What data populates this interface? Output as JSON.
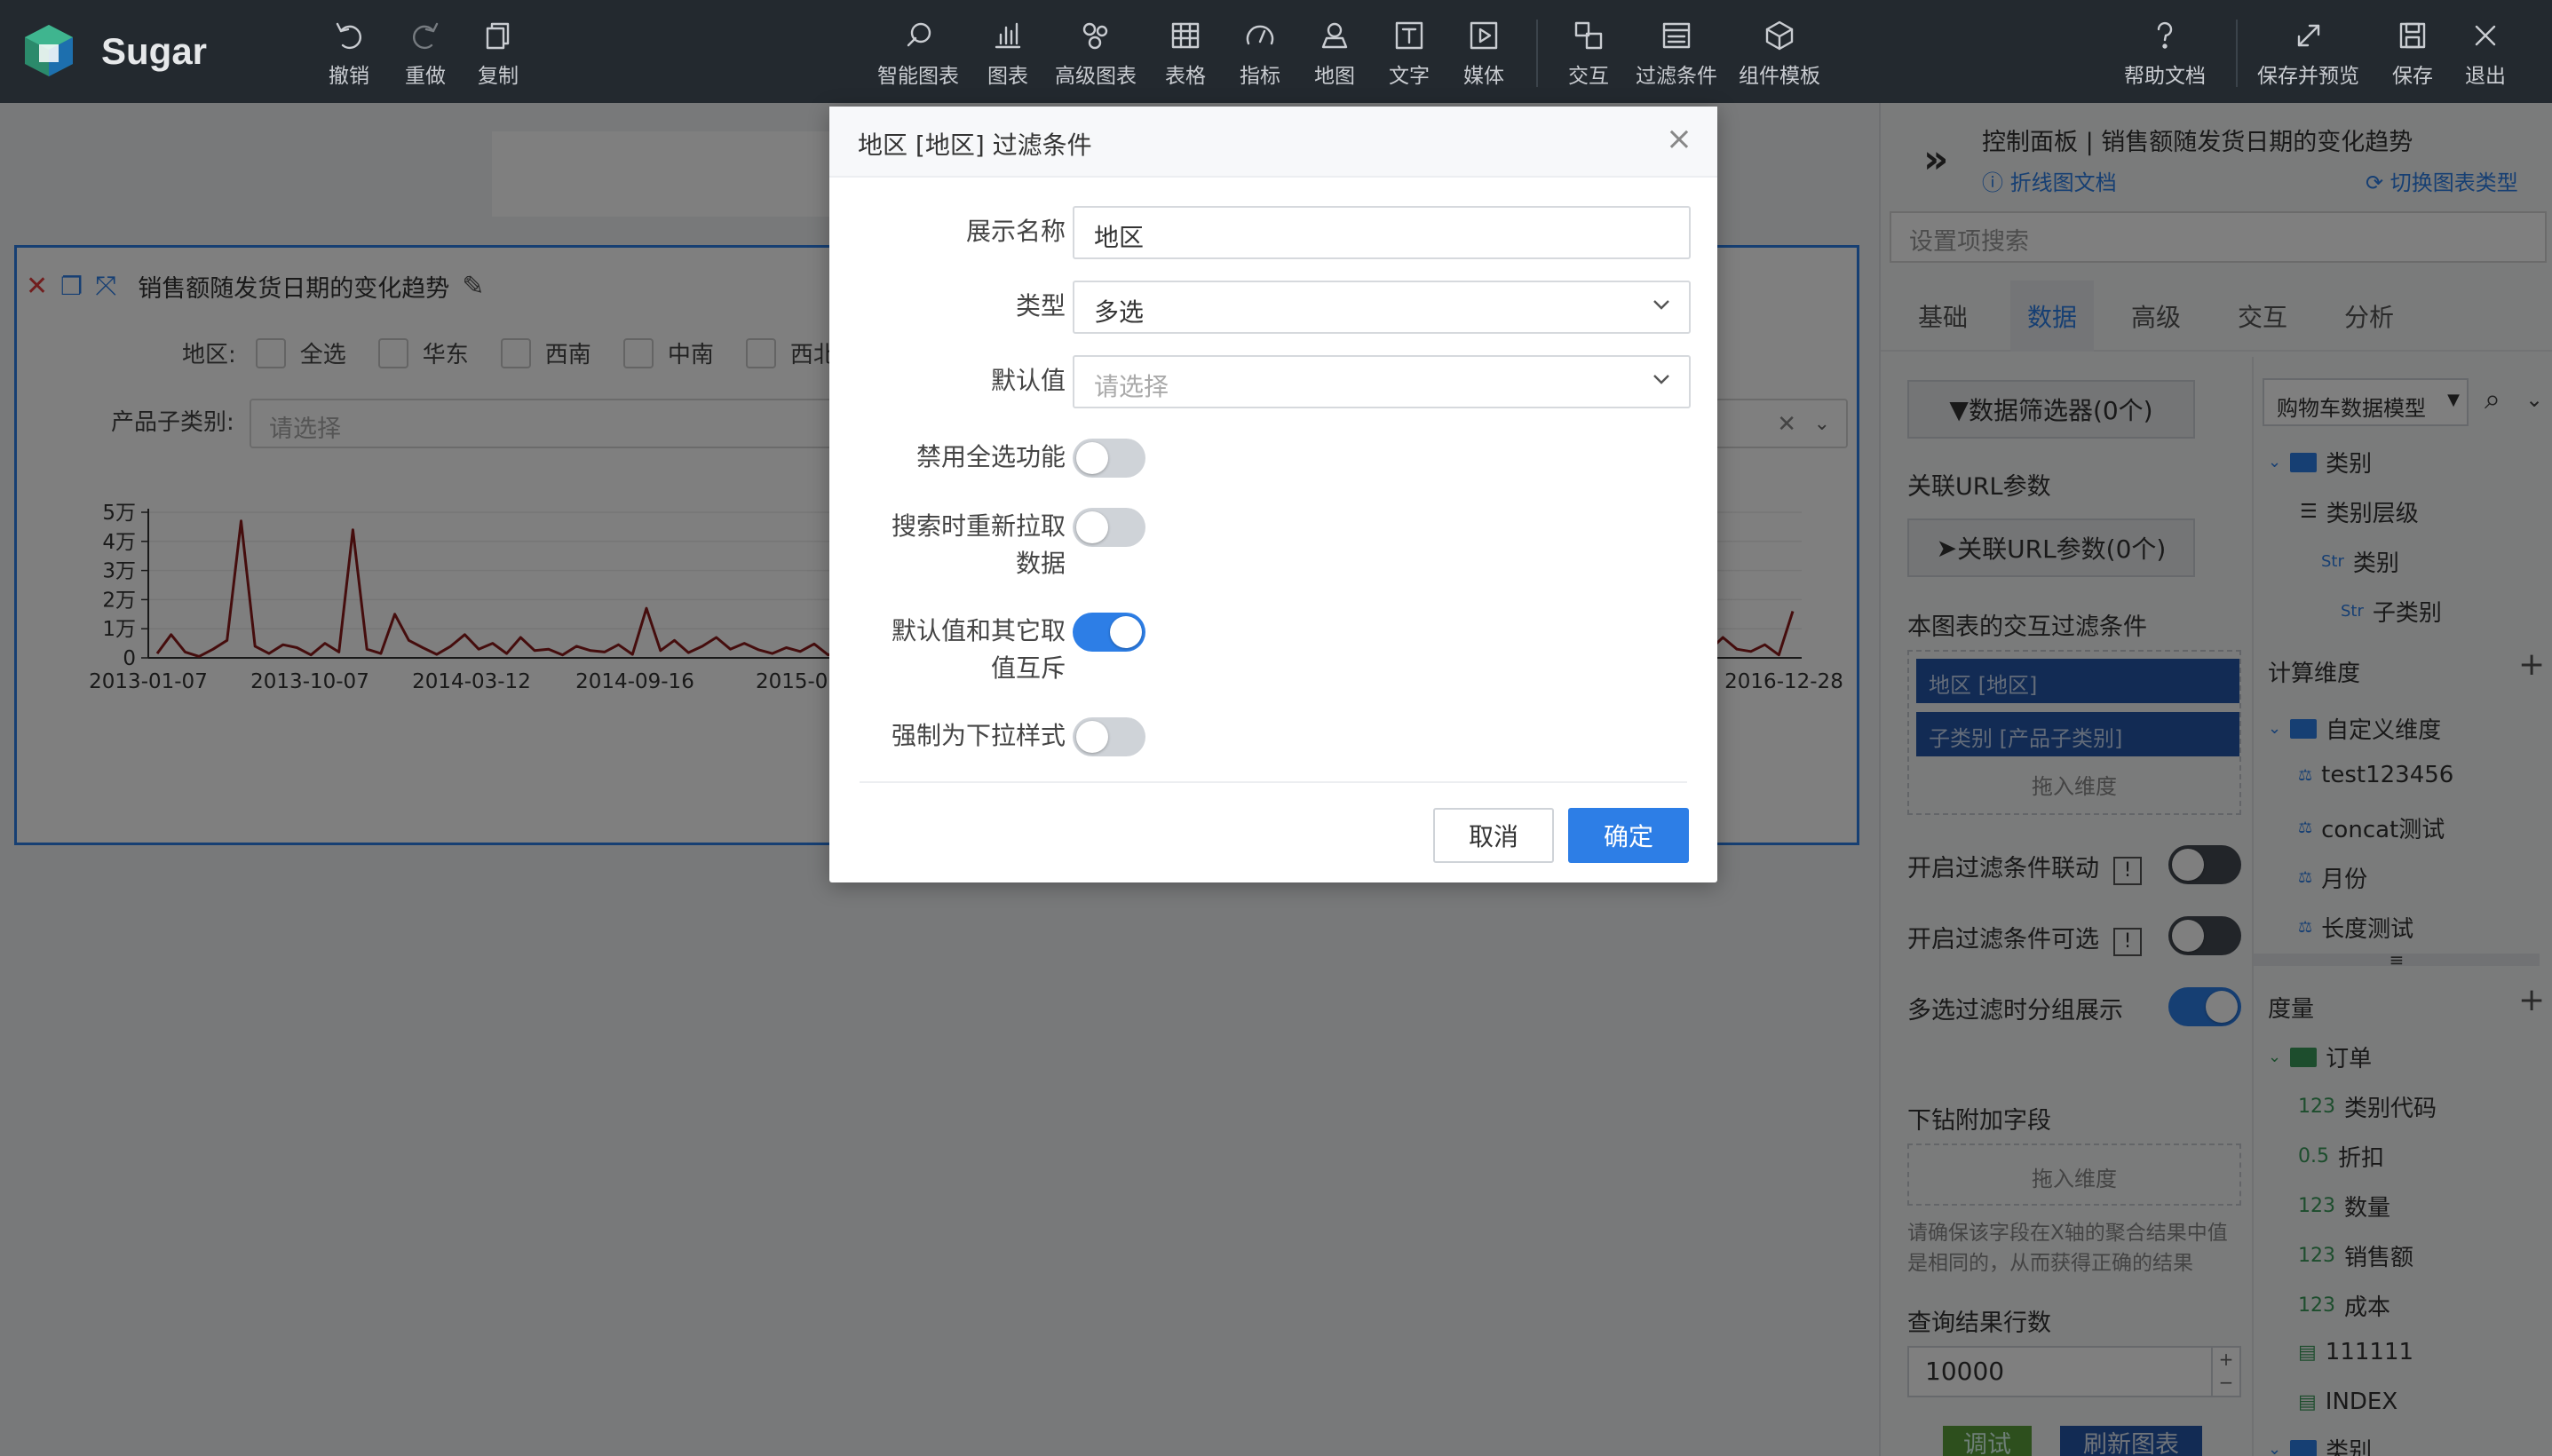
{
  "app": {
    "brand": "Sugar"
  },
  "toolbar": {
    "undo": "撤销",
    "redo": "重做",
    "copy": "复制",
    "smart_chart": "智能图表",
    "chart": "图表",
    "advanced_chart": "高级图表",
    "table": "表格",
    "indicator": "指标",
    "map": "地图",
    "text": "文字",
    "media": "媒体",
    "interaction": "交互",
    "filter": "过滤条件",
    "component_template": "组件模板",
    "help": "帮助文档",
    "save_preview": "保存并预览",
    "save": "保存",
    "exit": "退出"
  },
  "chart_card": {
    "title": "销售额随发货日期的变化趋势",
    "region_label": "地区:",
    "region_options": [
      "全选",
      "华东",
      "西南",
      "中南",
      "西北"
    ],
    "subcategory_label": "产品子类别:",
    "subcategory_placeholder": "请选择"
  },
  "chart_data": {
    "type": "line",
    "title": "",
    "xlabel": "",
    "ylabel": "",
    "y_ticks": [
      "0",
      "1万",
      "2万",
      "3万",
      "4万",
      "5万"
    ],
    "ylim": [
      0,
      50000
    ],
    "x_ticks": [
      "2013-01-07",
      "2013-10-07",
      "2014-03-12",
      "2014-09-16",
      "2015-02",
      "2016-12-28"
    ],
    "series": [
      {
        "color": "#8b1a1a",
        "values": [
          1500,
          8000,
          2000,
          500,
          3000,
          6000,
          47000,
          4000,
          1500,
          4500,
          3500,
          1000,
          5000,
          2000,
          44000,
          3000,
          1500,
          15000,
          6000,
          3500,
          1200,
          4000,
          8000,
          3000,
          5000,
          1500,
          7000,
          2500,
          3000,
          1000,
          4000,
          2500,
          2000,
          4500,
          1200,
          17000,
          2500,
          6000,
          1800,
          4000,
          7000,
          3000,
          5000,
          2800,
          1500,
          3500,
          2200,
          4800,
          1000,
          3000,
          2500,
          6000,
          4000,
          1500,
          11000,
          5000,
          32000,
          3500,
          4000,
          2000,
          5000,
          1500,
          3500,
          2500,
          4000,
          1200,
          2200,
          5000,
          3500,
          8000,
          1500,
          3000,
          2000,
          8500,
          2500,
          20000,
          5000,
          4500,
          8000,
          3000,
          25000,
          12000,
          7000,
          4500,
          2000,
          5000,
          3000,
          7000,
          1500,
          3000,
          4500,
          5000,
          2500,
          1500,
          3500,
          7000,
          1200,
          4500,
          3000,
          2500,
          6000,
          1000,
          3500,
          2000,
          4000,
          2500,
          1500,
          5000,
          3000,
          1800,
          4500,
          2500,
          7000,
          3000,
          2200,
          4500,
          1000,
          16000
        ]
      }
    ]
  },
  "modal": {
    "title": "地区 [地区] 过滤条件",
    "close_icon": "×",
    "display_name_label": "展示名称",
    "display_name_value": "地区",
    "type_label": "类型",
    "type_value": "多选",
    "default_label": "默认值",
    "default_placeholder": "请选择",
    "disable_select_all_label": "禁用全选功能",
    "refetch_on_search_label_1": "搜索时重新拉取",
    "refetch_on_search_label_2": "数据",
    "mutual_exclusive_label_1": "默认值和其它取",
    "mutual_exclusive_label_2": "值互斥",
    "force_dropdown_label": "强制为下拉样式",
    "toggles": {
      "disable_select_all": false,
      "refetch_on_search": false,
      "mutual_exclusive": true,
      "force_dropdown": false
    },
    "cancel": "取消",
    "ok": "确定"
  },
  "panel": {
    "title": "控制面板 | 销售额随发货日期的变化趋势",
    "doc_link": "折线图文档",
    "switch_link": "切换图表类型",
    "search_placeholder": "设置项搜索",
    "tabs": [
      "基础",
      "数据",
      "高级",
      "交互",
      "分析"
    ],
    "data_filter_btn": "数据筛选器(0个)",
    "url_params_label": "关联URL参数",
    "url_params_btn": "关联URL参数(0个)",
    "interaction_filter_label": "本图表的交互过滤条件",
    "chips": [
      "地区 [地区]",
      "子类别 [产品子类别]"
    ],
    "drag_dim": "拖入维度",
    "filter_link_label": "开启过滤条件联动",
    "filter_optional_label": "开启过滤条件可选",
    "multi_group_label": "多选过滤时分组展示",
    "drill_label": "下钻附加字段",
    "drill_hint": "请确保该字段在X轴的聚合结果中值是相同的，从而获得正确的结果",
    "query_rows_label": "查询结果行数",
    "query_rows_value": "10000",
    "debug_btn": "调试",
    "refresh_btn": "刷新图表",
    "model_select": "购物车数据模型",
    "tree": {
      "category_folder": "类别",
      "category_level": "类别层级",
      "category": "类别",
      "subcategory": "子类别",
      "calc_dims": "计算维度",
      "custom_dims": "自定义维度",
      "test": "test123456",
      "concat": "concat测试",
      "month": "月份",
      "length": "长度测试",
      "measures": "度量",
      "order": "订单",
      "cat_code": "类别代码",
      "discount": "折扣",
      "qty": "数量",
      "sales": "销售额",
      "cost": "成本",
      "num111": "111111",
      "index": "INDEX",
      "category_bottom": "类别",
      "str_tag": "Str",
      "num_tag": "123",
      "dec_tag": "0.5"
    }
  }
}
